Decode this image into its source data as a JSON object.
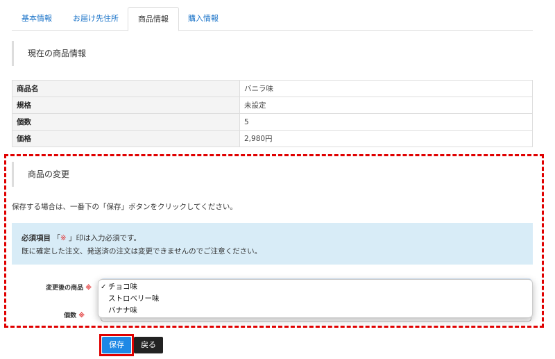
{
  "tabs": [
    {
      "label": "基本情報",
      "active": false
    },
    {
      "label": "お届け先住所",
      "active": false
    },
    {
      "label": "商品情報",
      "active": true
    },
    {
      "label": "購入情報",
      "active": false
    }
  ],
  "current_section": {
    "title": "現在の商品情報",
    "rows": [
      {
        "key": "商品名",
        "value": "バニラ味"
      },
      {
        "key": "規格",
        "value": "未設定"
      },
      {
        "key": "個数",
        "value": "5"
      },
      {
        "key": "価格",
        "value": "2,980円"
      }
    ]
  },
  "change_section": {
    "title": "商品の変更",
    "note": "保存する場合は、一番下の「保存」ボタンをクリックしてください。",
    "alert": {
      "required_label": "必須項目",
      "required_mark_open": " 「",
      "required_mark": "※",
      "required_mark_close": " 」印は入力必須です。",
      "line2": "既に確定した注文、発送済の注文は変更できませんのでご注意ください。"
    },
    "fields": {
      "product": {
        "label": "変更後の商品",
        "required_mark": "※",
        "options": [
          "チョコ味",
          "ストロベリー味",
          "バナナ味"
        ],
        "selected": "チョコ味"
      },
      "quantity": {
        "label": "個数",
        "required_mark": "※"
      }
    }
  },
  "buttons": {
    "save": "保存",
    "back": "戻る"
  },
  "icons": {
    "check": "check-icon",
    "select_arrows": "select-arrows-icon"
  },
  "colors": {
    "link": "#1a73c8",
    "alert_bg": "#d8ecf7",
    "required": "#e03131",
    "save_button": "#1e88e5",
    "back_button": "#222222",
    "highlight": "#e00000"
  }
}
